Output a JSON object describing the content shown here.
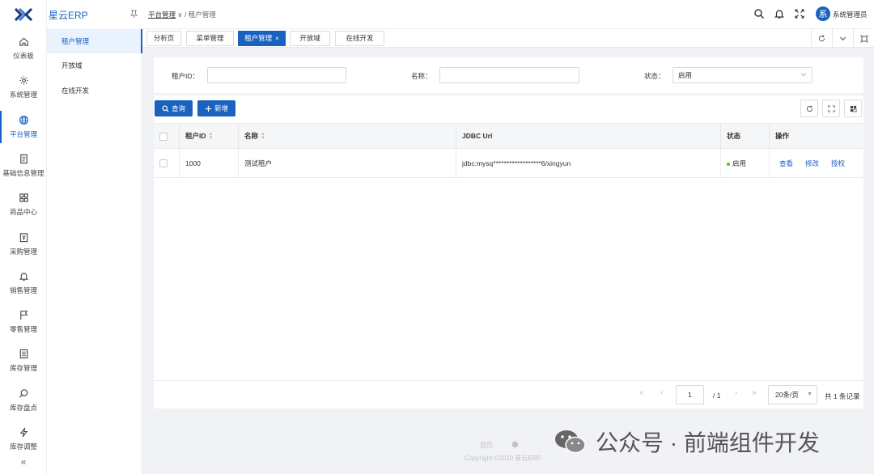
{
  "brand": {
    "name": "星云ERP"
  },
  "sidebar": {
    "items": [
      {
        "label": "仪表板",
        "icon": "home-icon"
      },
      {
        "label": "系统管理",
        "icon": "gear-icon"
      },
      {
        "label": "平台管理",
        "icon": "globe-icon",
        "active": true
      },
      {
        "label": "基础信息管理",
        "icon": "document-icon"
      },
      {
        "label": "商品中心",
        "icon": "grid-icon"
      },
      {
        "label": "采购管理",
        "icon": "purchase-icon"
      },
      {
        "label": "销售管理",
        "icon": "bell-icon"
      },
      {
        "label": "零售管理",
        "icon": "flag-icon"
      },
      {
        "label": "库存管理",
        "icon": "list-icon"
      },
      {
        "label": "库存盘点",
        "icon": "search-icon"
      },
      {
        "label": "库存调整",
        "icon": "lightning-icon"
      }
    ],
    "collapse_glyph": "«"
  },
  "header": {
    "breadcrumb": {
      "parent": "平台管理",
      "sep": "∨ /",
      "current": "租户管理"
    },
    "username": "系统管理员",
    "avatar_text": "系"
  },
  "submenu": {
    "items": [
      {
        "label": "租户管理",
        "active": true
      },
      {
        "label": "开放域"
      },
      {
        "label": "在线开发"
      }
    ]
  },
  "tabs": [
    {
      "label": "分析页"
    },
    {
      "label": "菜单管理"
    },
    {
      "label": "租户管理",
      "active": true,
      "close": "×"
    },
    {
      "label": "开放域"
    },
    {
      "label": "在线开发"
    }
  ],
  "search": {
    "tenant_id_label": "租户ID：",
    "tenant_id_value": "",
    "name_label": "名称：",
    "name_value": "",
    "status_label": "状态：",
    "status_value": "启用"
  },
  "toolbar": {
    "query_label": "查询",
    "add_label": "新增"
  },
  "table": {
    "columns": [
      "租户ID",
      "名称",
      "JDBC Url",
      "状态",
      "操作"
    ],
    "rows": [
      {
        "id": "1000",
        "name": "测试租户",
        "jdbc": "jdbc:mysq******************6/xingyun",
        "status": "启用",
        "actions": [
          "查看",
          "修改",
          "授权"
        ]
      }
    ]
  },
  "pagination": {
    "current": "1",
    "total_pages": "/ 1",
    "page_size": "20条/页",
    "total_text": "共 1 条记录"
  },
  "footer": {
    "home": "首页",
    "copyright": "Copyright ©2020 星云ERP"
  },
  "watermark": {
    "text": "公众号 · 前端组件开发"
  },
  "colors": {
    "primary": "#1a62c0",
    "status_on": "#52c41a"
  }
}
